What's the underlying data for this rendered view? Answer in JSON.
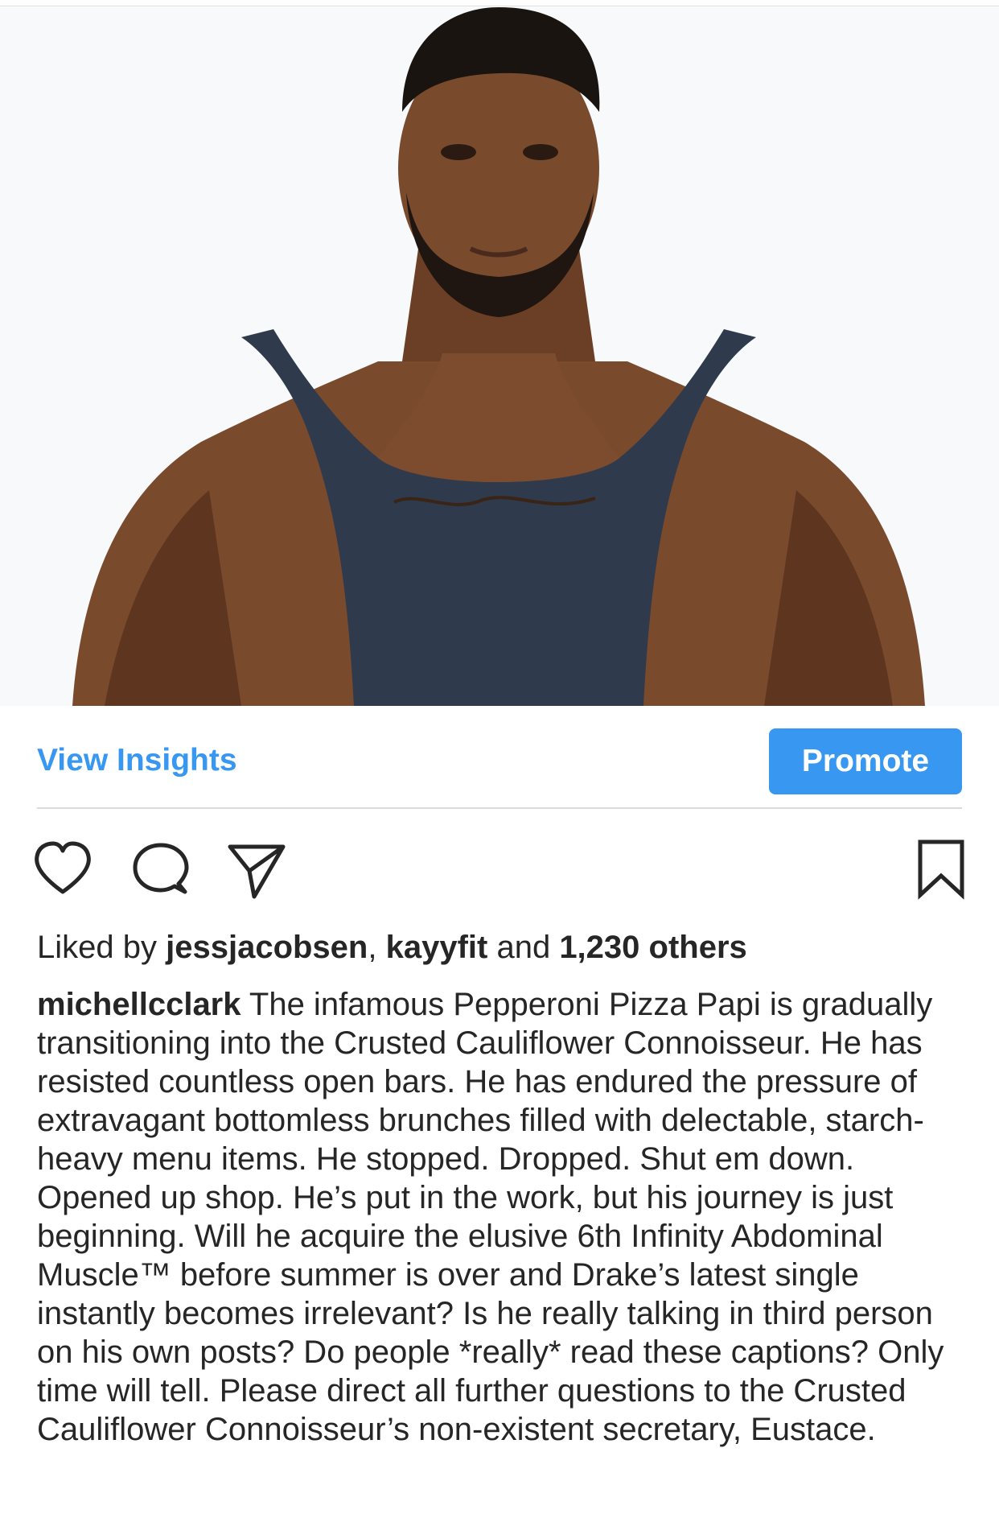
{
  "post": {
    "photo_subject": "portrait-photo"
  },
  "insights_bar": {
    "view_insights_label": "View Insights",
    "promote_label": "Promote"
  },
  "actions": {
    "like_icon": "heart-icon",
    "comment_icon": "comment-icon",
    "share_icon": "share-icon",
    "save_icon": "bookmark-icon"
  },
  "likes": {
    "prefix": "Liked by ",
    "user1": "jessjacobsen",
    "separator": ", ",
    "user2": "kayyfit",
    "conjunction": " and ",
    "others": "1,230 others"
  },
  "caption": {
    "username": "michellcclark",
    "text": " The infamous Pepperoni Pizza Papi is gradually transitioning into the Crusted Cauliflower Connoisseur. He has resisted countless open bars. He has endured the pressure of extravagant bottomless brunches filled with delectable, starch-heavy menu items. He stopped. Dropped. Shut em down. Opened up shop. He’s put in the work, but his journey is just beginning. Will he acquire the elusive 6th Infinity Abdominal Muscle™ before summer is over and Drake’s latest single instantly becomes irrelevant? Is he really talking in third person on his own posts? Do people *really* read these captions? Only time will tell. Please direct all further questions to the Crusted Cauliflower Connoisseur’s non-existent secretary, Eustace."
  },
  "colors": {
    "accent": "#3897f0",
    "text": "#262626",
    "divider": "#dbdbdb"
  }
}
